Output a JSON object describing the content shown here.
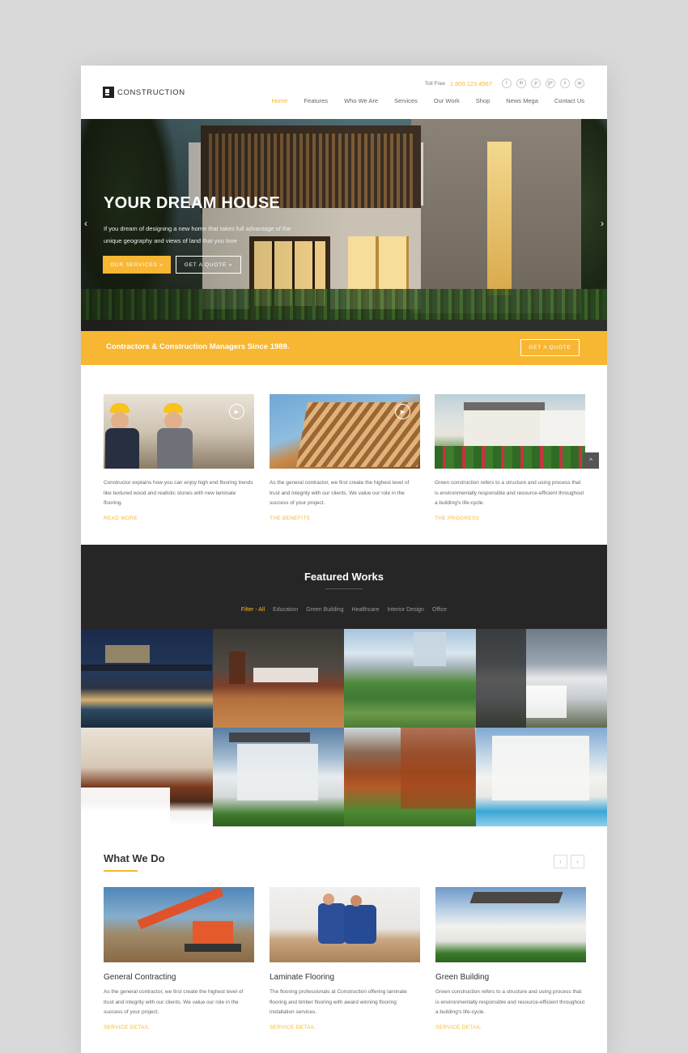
{
  "header": {
    "logo_text": "CONSTRUCTION",
    "toll_free_label": "Toll Free",
    "toll_free_number": "1.800.123.4567",
    "social_icons": [
      "twitter-icon",
      "linkedin-icon",
      "pinterest-icon",
      "google-plus-icon",
      "skype-icon",
      "email-icon"
    ],
    "nav": [
      {
        "label": "Home",
        "active": true
      },
      {
        "label": "Features"
      },
      {
        "label": "Who We Are"
      },
      {
        "label": "Services"
      },
      {
        "label": "Our Work"
      },
      {
        "label": "Shop"
      },
      {
        "label": "News Mega"
      },
      {
        "label": "Contact Us"
      }
    ]
  },
  "hero": {
    "title": "YOUR DREAM HOUSE",
    "text": "If you dream of designing a new home that takes full advantage of the unique geography and views of land that you love",
    "btn_services": "OUR SERVICES »",
    "btn_quote": "GET A QUOTE »",
    "arrow_prev": "‹",
    "arrow_next": "›"
  },
  "banner": {
    "text": "Contractors & Construction Managers Since 1989.",
    "button": "GET A QUOTE"
  },
  "intro": {
    "cards": [
      {
        "text": "Constructor explains how you can enjoy high end flooring trends like textured wood and realistic stones with new laminate flooring.",
        "link": "READ MORE"
      },
      {
        "text": "As the general contractor, we first create the highest level of trust and integrity with our clients. We value our role in the success of your project.",
        "link": "THE BENEFITS"
      },
      {
        "text": "Green construction refers to a structure and using process that is environmentally responsible and resource-efficient throughout a building's life-cycle.",
        "link": "THE PROGRESS"
      }
    ],
    "play_symbol": "▶",
    "scroll_up_symbol": "^"
  },
  "featured": {
    "title": "Featured Works",
    "filters": [
      "Filter - All",
      "Education",
      "Green Building",
      "Healthcare",
      "Interior Design",
      "Office"
    ]
  },
  "what_we_do": {
    "title": "What We Do",
    "nav_prev": "‹",
    "nav_next": "›",
    "cards": [
      {
        "title": "General Contracting",
        "text": "As the general contractor, we first create the highest level of trust and integrity with our clients. We value our role in the success of your project.",
        "link": "SERVICE DETAIL"
      },
      {
        "title": "Laminate Flooring",
        "text": "The flooring professionals at Construction offering laminate flooring and timber flooring with award winning flooring installation services.",
        "link": "SERVICE DETAIL"
      },
      {
        "title": "Green Building",
        "text": "Green construction refers to a structure and using process that is environmentally responsible and resource-efficient throughout a building's life-cycle.",
        "link": "SERVICE DETAIL"
      }
    ]
  },
  "colors": {
    "accent": "#f7b733",
    "dark_section": "#262626"
  }
}
